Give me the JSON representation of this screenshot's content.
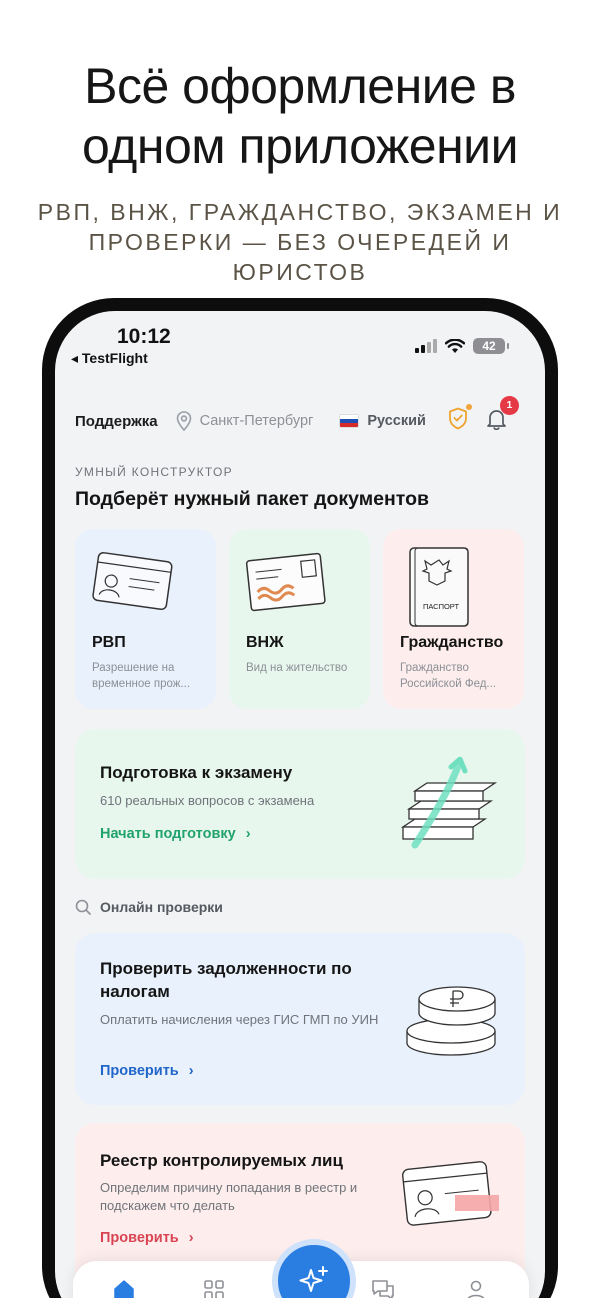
{
  "promo": {
    "title_line1": "Всё оформление в",
    "title_line2": "одном приложении",
    "subtitle_line1": "РВП, ВНЖ, ГРАЖДАНСТВО, ЭКЗАМЕН И",
    "subtitle_line2": "ПРОВЕРКИ — БЕЗ ОЧЕРЕДЕЙ И",
    "subtitle_line3": "ЮРИСТОВ"
  },
  "status_bar": {
    "time": "10:12",
    "back_app": "◂ TestFlight",
    "battery": "42"
  },
  "header": {
    "support": "Поддержка",
    "city": "Санкт-Петербург",
    "language": "Русский",
    "notifications_count": "1"
  },
  "constructor": {
    "kicker": "УМНЫЙ КОНСТРУКТОР",
    "headline": "Подберёт нужный пакет документов",
    "cards": [
      {
        "title": "РВП",
        "desc": "Разрешение на временное прож...",
        "bg": "#e9f1fc"
      },
      {
        "title": "ВНЖ",
        "desc": "Вид на жительство",
        "bg": "#e8f7ee"
      },
      {
        "title": "Гражданство",
        "desc": "Гражданство Российской Фед...",
        "bg": "#fdeeed",
        "passport_label": "ПАСПОРТ"
      }
    ]
  },
  "exam": {
    "title": "Подготовка к экзамену",
    "subtitle": "610 реальных вопросов с экзамена",
    "link": "Начать подготовку"
  },
  "online_checks": {
    "header": "Онлайн проверки",
    "items": [
      {
        "title": "Проверить задолженности по налогам",
        "desc": "Оплатить начисления через ГИС ГМП по УИН",
        "link": "Проверить",
        "accent": "#2166c9"
      },
      {
        "title": "Реестр контролируемых лиц",
        "desc": "Определим причину попадания в реестр и подскажем что делать",
        "link": "Проверить",
        "accent": "#d94452"
      }
    ]
  },
  "tabbar": {
    "items": [
      "home-icon",
      "grid-icon",
      "sparkles-icon",
      "chat-icon",
      "profile-icon"
    ],
    "active": "home-icon",
    "accent": "#2a7de1"
  }
}
